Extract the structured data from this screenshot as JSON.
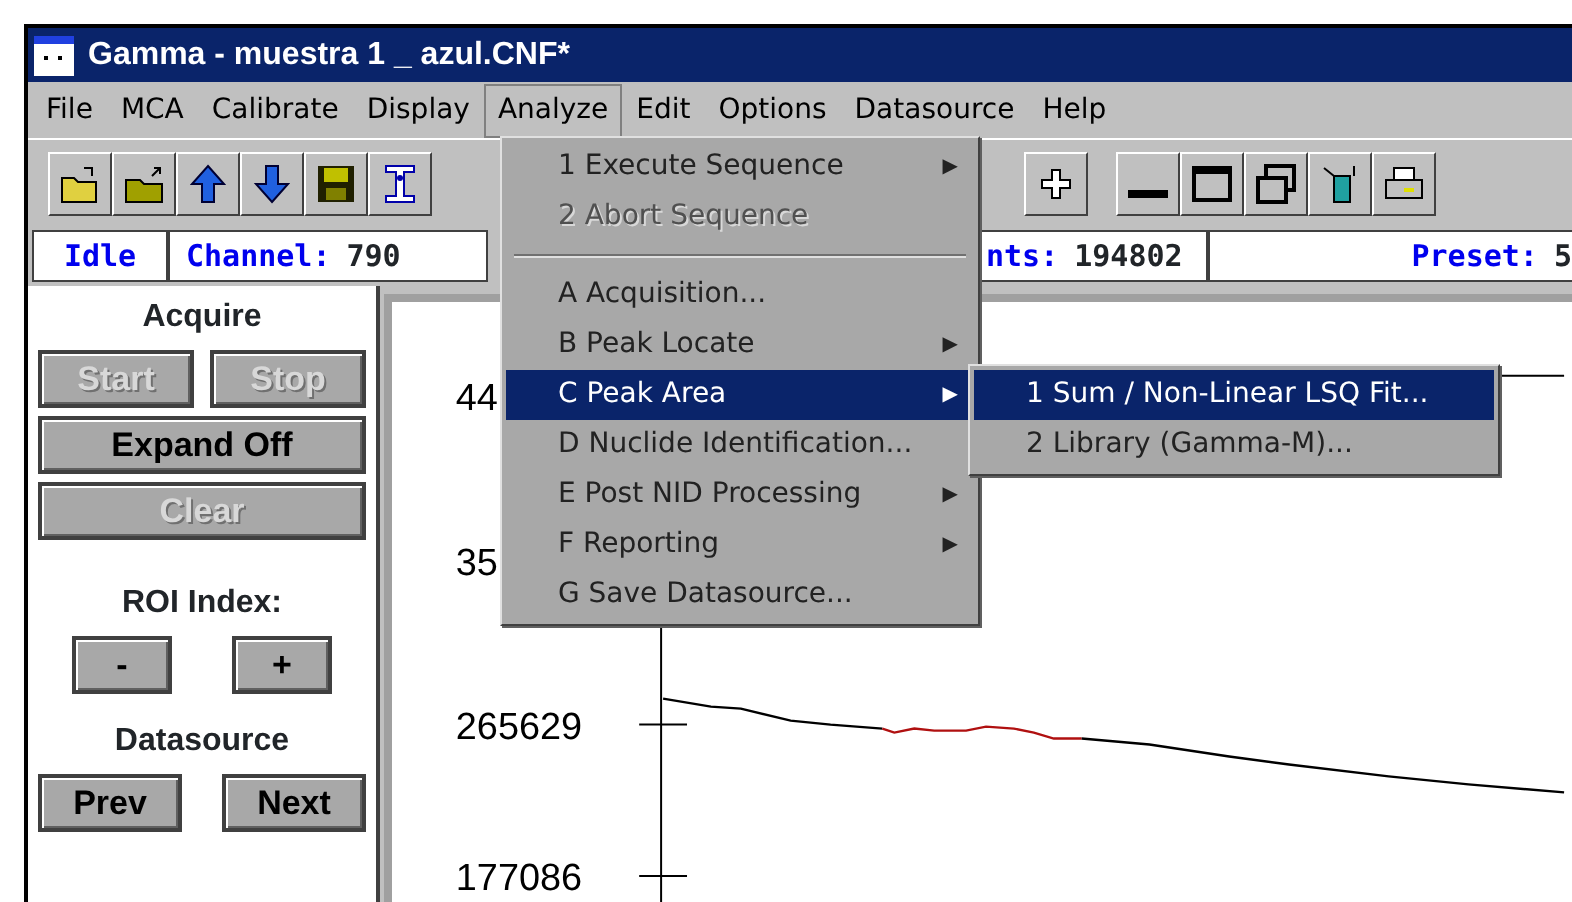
{
  "window": {
    "title": "Gamma - muestra 1 _ azul.CNF*"
  },
  "menu_bar": [
    {
      "label": "File",
      "selected": false
    },
    {
      "label": "MCA",
      "selected": false
    },
    {
      "label": "Calibrate",
      "selected": false
    },
    {
      "label": "Display",
      "selected": false
    },
    {
      "label": "Analyze",
      "selected": true
    },
    {
      "label": "Edit",
      "selected": false
    },
    {
      "label": "Options",
      "selected": false
    },
    {
      "label": "Datasource",
      "selected": false
    },
    {
      "label": "Help",
      "selected": false
    }
  ],
  "status_bar": [
    {
      "label": "Idle"
    },
    {
      "label": "Channel:",
      "value": "790"
    },
    {
      "label": "nts:",
      "value": "194802"
    },
    {
      "label": "Preset:",
      "value": "5"
    }
  ],
  "left_panel": {
    "acquire_title": "Acquire",
    "acquire_rows": [
      [
        {
          "label": "Start",
          "disabled": true
        },
        {
          "label": "Stop",
          "disabled": true
        }
      ],
      [
        {
          "label": "Expand Off",
          "disabled": false
        }
      ],
      [
        {
          "label": "Clear",
          "disabled": true
        }
      ]
    ],
    "roi_title": "ROI Index:",
    "roi_buttons": [
      "-",
      "+"
    ],
    "datasource_title": "Datasource",
    "datasource_buttons": [
      "Prev",
      "Next"
    ]
  },
  "plot": {
    "y_tick_labels": [
      "44",
      "35",
      "265629",
      "177086"
    ]
  },
  "analyze_menu": [
    {
      "kind": "item",
      "label": "1 Execute Sequence",
      "submenu": true,
      "disabled": false,
      "selected": false
    },
    {
      "kind": "item",
      "label": "2 Abort Sequence",
      "submenu": false,
      "disabled": true,
      "selected": false
    },
    {
      "kind": "separator"
    },
    {
      "kind": "item",
      "label": "A Acquisition...",
      "submenu": false,
      "disabled": false,
      "selected": false
    },
    {
      "kind": "item",
      "label": "B Peak Locate",
      "submenu": true,
      "disabled": false,
      "selected": false
    },
    {
      "kind": "item",
      "label": "C Peak Area",
      "submenu": true,
      "disabled": false,
      "selected": true
    },
    {
      "kind": "item",
      "label": "D Nuclide Identification...",
      "submenu": false,
      "disabled": false,
      "selected": false
    },
    {
      "kind": "item",
      "label": "E Post NID Processing",
      "submenu": true,
      "disabled": false,
      "selected": false
    },
    {
      "kind": "item",
      "label": "F Reporting",
      "submenu": true,
      "disabled": false,
      "selected": false
    },
    {
      "kind": "item",
      "label": "G Save Datasource...",
      "submenu": false,
      "disabled": false,
      "selected": false
    }
  ],
  "peak_area_submenu": [
    {
      "label": "1 Sum / Non-Linear LSQ Fit...",
      "selected": true
    },
    {
      "label": "2 Library (Gamma-M)...",
      "selected": false
    }
  ],
  "submenu_arrow": "▶"
}
